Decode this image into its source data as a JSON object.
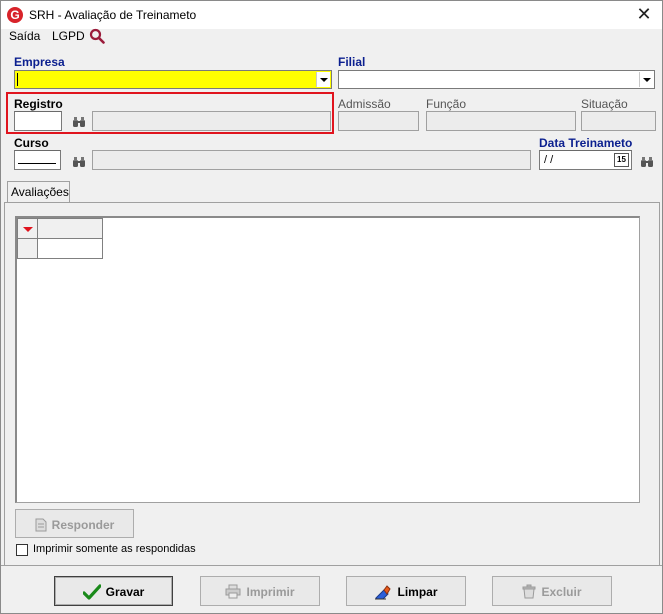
{
  "window": {
    "title": "SRH - Avaliação de Treinameto",
    "app_icon_letter": "G",
    "close_glyph": "✕"
  },
  "menu": {
    "items": [
      "Saída",
      "LGPD"
    ]
  },
  "form": {
    "empresa_label": "Empresa",
    "filial_label": "Filial",
    "registro_label": "Registro",
    "admissao_label": "Admissão",
    "funcao_label": "Função",
    "situacao_label": "Situação",
    "curso_label": "Curso",
    "data_treinamento_label": "Data Treinameto",
    "data_treinamento_value": " / /",
    "calendar_day": "15"
  },
  "tabs": [
    {
      "label": "Avaliações",
      "active": true
    }
  ],
  "buttons": {
    "responder": "Responder",
    "gravar": "Gravar",
    "imprimir": "Imprimir",
    "limpar": "Limpar",
    "excluir": "Excluir"
  },
  "checkbox": {
    "label": "Imprimir somente as respondidas",
    "checked": false
  },
  "colors": {
    "required_field": "#ffff00",
    "highlight_border": "#e0141e",
    "label_blue": "#0b1f8f",
    "brand_red": "#d8232a"
  },
  "icons": [
    "search-icon",
    "binoculars-icon",
    "calendar-icon",
    "checkmark-icon",
    "printer-icon",
    "eraser-icon",
    "trash-icon",
    "document-icon"
  ]
}
